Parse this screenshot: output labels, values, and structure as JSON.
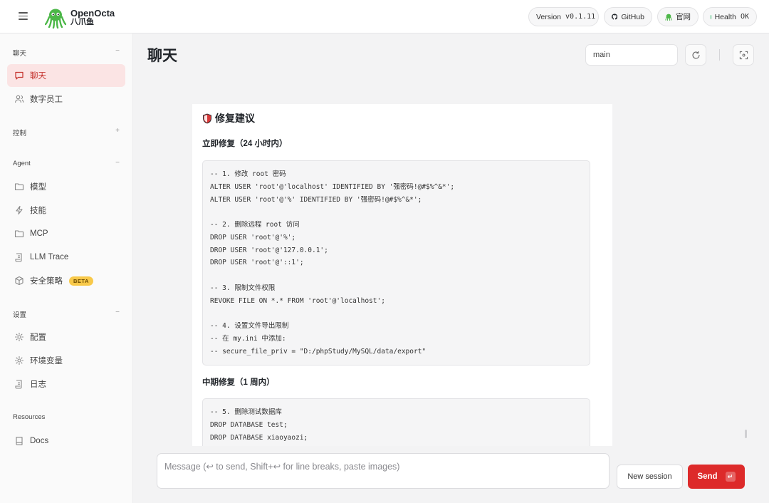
{
  "brand": {
    "name_en": "OpenOcta",
    "name_cn": "八爪鱼"
  },
  "header": {
    "version_label": "Version",
    "version_value": "v0.1.11",
    "github_label": "GitHub",
    "site_label": "官网",
    "health_label": "Health",
    "health_value": "OK"
  },
  "sidebar": {
    "sections": [
      {
        "title": "聊天",
        "toggle": "−"
      },
      {
        "title": "控制",
        "toggle": "+"
      },
      {
        "title": "Agent",
        "toggle": "−"
      },
      {
        "title": "设置",
        "toggle": "−"
      },
      {
        "title": "Resources",
        "toggle": ""
      }
    ],
    "items": [
      {
        "label": "聊天",
        "icon": "chat-icon"
      },
      {
        "label": "数字员工",
        "icon": "users-icon"
      },
      {
        "label": "模型",
        "icon": "folder-icon"
      },
      {
        "label": "技能",
        "icon": "lightning-icon"
      },
      {
        "label": "MCP",
        "icon": "folder-icon"
      },
      {
        "label": "LLM Trace",
        "icon": "scroll-icon"
      },
      {
        "label": "安全策略",
        "icon": "cube-icon",
        "badge": "BETA"
      },
      {
        "label": "配置",
        "icon": "gear-icon"
      },
      {
        "label": "环境变量",
        "icon": "gear-icon"
      },
      {
        "label": "日志",
        "icon": "scroll-icon"
      },
      {
        "label": "Docs",
        "icon": "book-icon"
      }
    ]
  },
  "main": {
    "title": "聊天",
    "session_key": "main"
  },
  "message": {
    "title": "修复建议",
    "sections": [
      {
        "heading": "立即修复（24 小时内）",
        "lines": [
          "-- 1. 修改 root 密码",
          "ALTER USER 'root'@'localhost' IDENTIFIED BY '强密码!@#$%^&*';",
          "ALTER USER 'root'@'%' IDENTIFIED BY '强密码!@#$%^&*';",
          "",
          "-- 2. 删除远程 root 访问",
          "DROP USER 'root'@'%';",
          "DROP USER 'root'@'127.0.0.1';",
          "DROP USER 'root'@'::1';",
          "",
          "-- 3. 限制文件权限",
          "REVOKE FILE ON *.* FROM 'root'@'localhost';",
          "",
          "-- 4. 设置文件导出限制",
          "-- 在 my.ini 中添加:",
          "-- secure_file_priv = \"D:/phpStudy/MySQL/data/export\""
        ]
      },
      {
        "heading": "中期修复（1 周内）",
        "lines": [
          "-- 5. 删除测试数据库",
          "DROP DATABASE test;",
          "DROP DATABASE xiaoyaozi;"
        ]
      }
    ]
  },
  "composer": {
    "placeholder": "Message (↩ to send, Shift+↩ for line breaks, paste images)",
    "new_session_label": "New session",
    "send_label": "Send",
    "send_kbd": "↵"
  },
  "colors": {
    "accent": "#dd2a2a",
    "active_bg": "#fbe4e4",
    "health_dot": "#22b35e",
    "beta_badge": "#f8c94a"
  }
}
